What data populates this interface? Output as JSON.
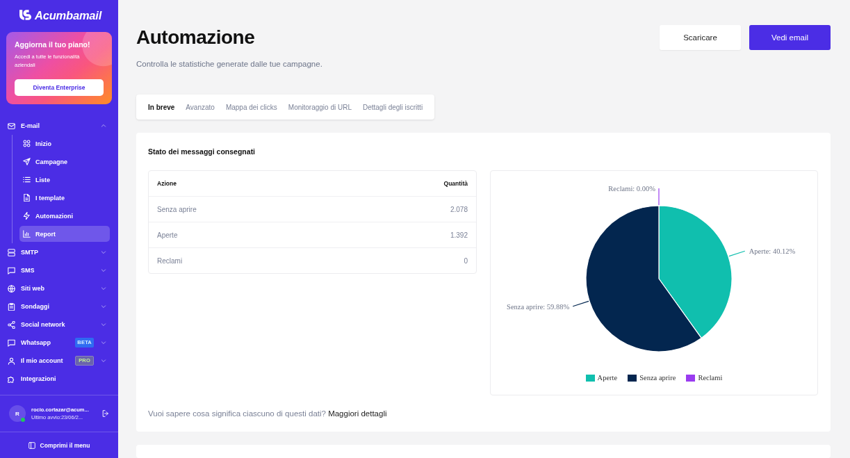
{
  "sidebar": {
    "logo": "Acumbamail",
    "promo": {
      "title": "Aggiorna il tuo piano!",
      "text": "Accedi a tutte le funzionalità aziendali",
      "button": "Diventa Enterprise"
    },
    "nav": [
      {
        "label": "E-mail",
        "selected": false,
        "expanded": true,
        "children": [
          {
            "label": "Inizio",
            "selected": false
          },
          {
            "label": "Campagne",
            "selected": false
          },
          {
            "label": "Liste",
            "selected": false
          },
          {
            "label": "I template",
            "selected": false
          },
          {
            "label": "Automazioni",
            "selected": false
          },
          {
            "label": "Report",
            "selected": true
          }
        ]
      },
      {
        "label": "SMTP",
        "selected": false,
        "expanded": false
      },
      {
        "label": "SMS",
        "selected": false,
        "expanded": false
      },
      {
        "label": "Siti web",
        "selected": false,
        "expanded": false
      },
      {
        "label": "Sondaggi",
        "selected": false,
        "expanded": false
      },
      {
        "label": "Social network",
        "selected": false,
        "expanded": false
      },
      {
        "label": "Whatsapp",
        "selected": false,
        "expanded": false,
        "badge": {
          "text": "BETA",
          "kind": "beta"
        }
      },
      {
        "label": "Il mio account",
        "selected": false,
        "expanded": false,
        "badge": {
          "text": "PRO",
          "kind": "pro"
        }
      },
      {
        "label": "Integrazioni",
        "selected": false
      }
    ],
    "user": {
      "initial": "R",
      "online": true,
      "email": "rocio.cortazar@acum...",
      "last_login": "Ultimo avvio:23/06/2..."
    },
    "collapse": "Comprimi il menu"
  },
  "header": {
    "title": "Automazione",
    "subtitle": "Controlla le statistiche generate dalle tue campagne.",
    "buttons": [
      {
        "label": "Scaricare",
        "kind": "secondary"
      },
      {
        "label": "Vedi email",
        "kind": "primary"
      }
    ]
  },
  "tabs": [
    {
      "label": "In breve",
      "selected": true
    },
    {
      "label": "Avanzato",
      "selected": false
    },
    {
      "label": "Mappa dei clicks",
      "selected": false
    },
    {
      "label": "Monitoraggio di URL",
      "selected": false
    },
    {
      "label": "Dettagli degli iscritti",
      "selected": false
    }
  ],
  "report": {
    "title": "Stato dei messaggi consegnati",
    "table": {
      "columns": [
        "Azione",
        "Quantità"
      ],
      "rows": [
        [
          "Senza aprire",
          "2.078"
        ],
        [
          "Aperte",
          "1.392"
        ],
        [
          "Reclami",
          "0"
        ]
      ]
    },
    "chart_data": {
      "type": "pie",
      "categories": [
        "Aperte",
        "Senza aprire",
        "Reclami"
      ],
      "values": [
        40.12,
        59.88,
        0
      ],
      "colors": [
        "#10bfae",
        "#03264f",
        "#9a3cf0"
      ],
      "value_labels": [
        "Aperte: 40.12%",
        "Senza aprire: 59.88%",
        "Reclami: 0.00%"
      ],
      "legend": "bottom"
    },
    "footer": {
      "text": "Vuoi sapere cosa significa ciascuno di questi dati?",
      "link": "Maggiori dettagli"
    }
  }
}
